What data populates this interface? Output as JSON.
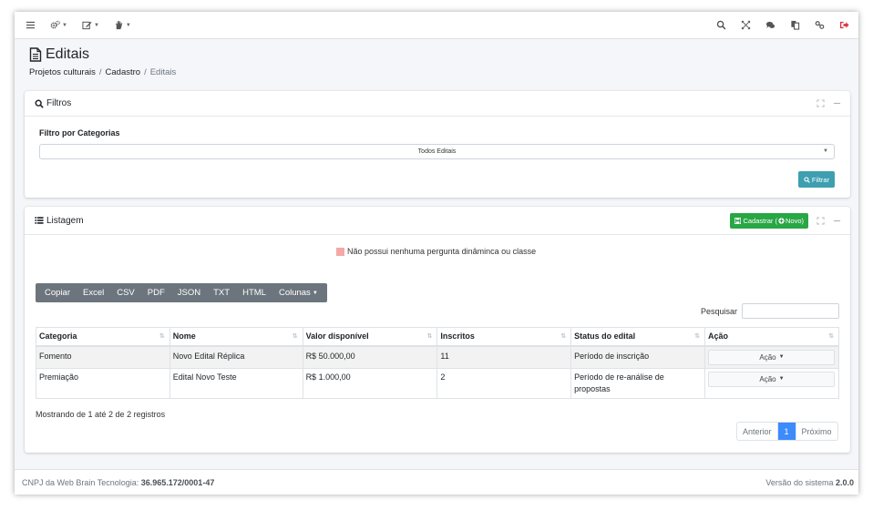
{
  "navbar": {
    "left": [
      "menu-icon",
      "gears-icon",
      "edit-icon",
      "hand-icon"
    ],
    "right": [
      "search-icon",
      "expand-icon",
      "comments-icon",
      "copy-icon",
      "link-icon",
      "sign-out-icon"
    ],
    "signout_color": "#dc3545"
  },
  "header": {
    "title": "Editais",
    "breadcrumb": [
      "Projetos culturais",
      "Cadastro",
      "Editais"
    ]
  },
  "filtros": {
    "title": "Filtros",
    "label": "Filtro por Categorias",
    "select_value": "Todos Editais",
    "button": "Filtrar"
  },
  "listagem": {
    "title": "Listagem",
    "cadastrar_button": "Cadastrar (",
    "novo_label": "Novo)",
    "legend": "Não possui nenhuma pergunta dinâminca ou classe",
    "export_buttons": [
      "Copiar",
      "Excel",
      "CSV",
      "PDF",
      "JSON",
      "TXT",
      "HTML",
      "Colunas"
    ],
    "search_label": "Pesquisar",
    "search_value": "",
    "columns": [
      "Categoria",
      "Nome",
      "Valor disponível",
      "Inscritos",
      "Status do edital",
      "Ação"
    ],
    "rows": [
      {
        "categoria": "Fomento",
        "nome": "Novo Edital Réplica",
        "valor": "R$ 50.000,00",
        "inscritos": "11",
        "status": "Período de inscrição",
        "acao": "Ação"
      },
      {
        "categoria": "Premiação",
        "nome": "Edital Novo Teste",
        "valor": "R$ 1.000,00",
        "inscritos": "2",
        "status": "Período de re-análise de propostas",
        "acao": "Ação"
      }
    ],
    "info": "Mostrando de 1 até 2 de 2 registros",
    "pagination": {
      "prev": "Anterior",
      "current": "1",
      "next": "Próximo"
    }
  },
  "footer": {
    "left_label": "CNPJ da Web Brain Tecnologia: ",
    "cnpj": "36.965.172/0001-47",
    "right_label": "Versão do sistema ",
    "version": "2.0.0"
  },
  "colors": {
    "accent_green": "#28a745",
    "accent_teal": "#3d9fb0",
    "legend_swatch": "#f4a8a8",
    "pagination_active": "#3d8bfd"
  }
}
